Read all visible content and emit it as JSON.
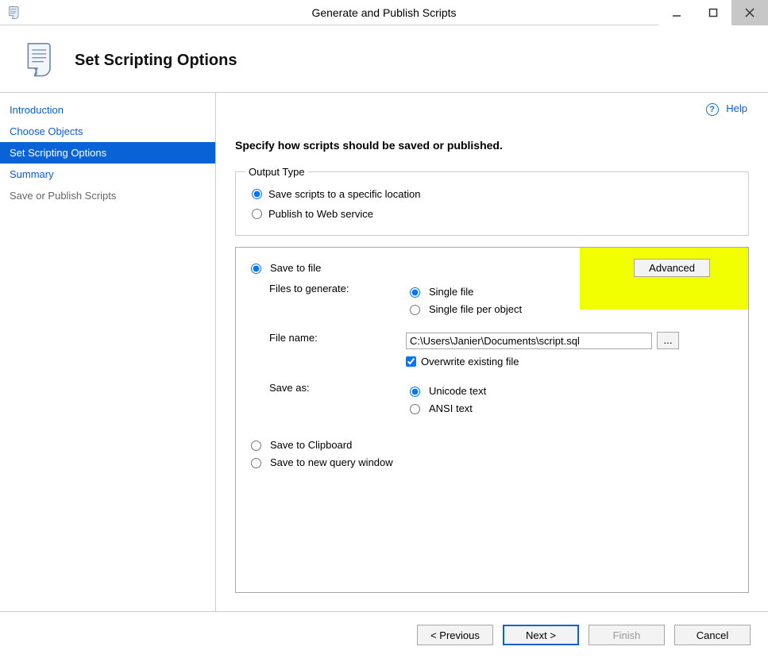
{
  "window": {
    "title": "Generate and Publish Scripts"
  },
  "header": {
    "page_title": "Set Scripting Options"
  },
  "help": {
    "label": "Help"
  },
  "sidebar": {
    "items": [
      {
        "label": "Introduction",
        "kind": "link"
      },
      {
        "label": "Choose Objects",
        "kind": "link"
      },
      {
        "label": "Set Scripting Options",
        "kind": "selected"
      },
      {
        "label": "Summary",
        "kind": "link"
      },
      {
        "label": "Save or Publish Scripts",
        "kind": "disabled"
      }
    ]
  },
  "main": {
    "heading": "Specify how scripts should be saved or published.",
    "output_type": {
      "legend": "Output Type",
      "save_location_label": "Save scripts to a specific location",
      "publish_label": "Publish to Web service",
      "selected": "save_location"
    },
    "advanced_button": "Advanced",
    "save_to_file": {
      "label": "Save to file",
      "selected": true,
      "files_to_generate_label": "Files to generate:",
      "single_file_label": "Single file",
      "single_file_per_object_label": "Single file per object",
      "files_mode": "single",
      "file_name_label": "File name:",
      "file_name_value": "C:\\Users\\Janier\\Documents\\script.sql",
      "browse_label": "...",
      "overwrite_label": "Overwrite existing file",
      "overwrite_checked": true,
      "save_as_label": "Save as:",
      "unicode_label": "Unicode text",
      "ansi_label": "ANSI text",
      "encoding": "unicode"
    },
    "save_to_clipboard_label": "Save to Clipboard",
    "save_to_new_query_label": "Save to new query window"
  },
  "footer": {
    "previous": "< Previous",
    "next": "Next >",
    "finish": "Finish",
    "cancel": "Cancel"
  }
}
